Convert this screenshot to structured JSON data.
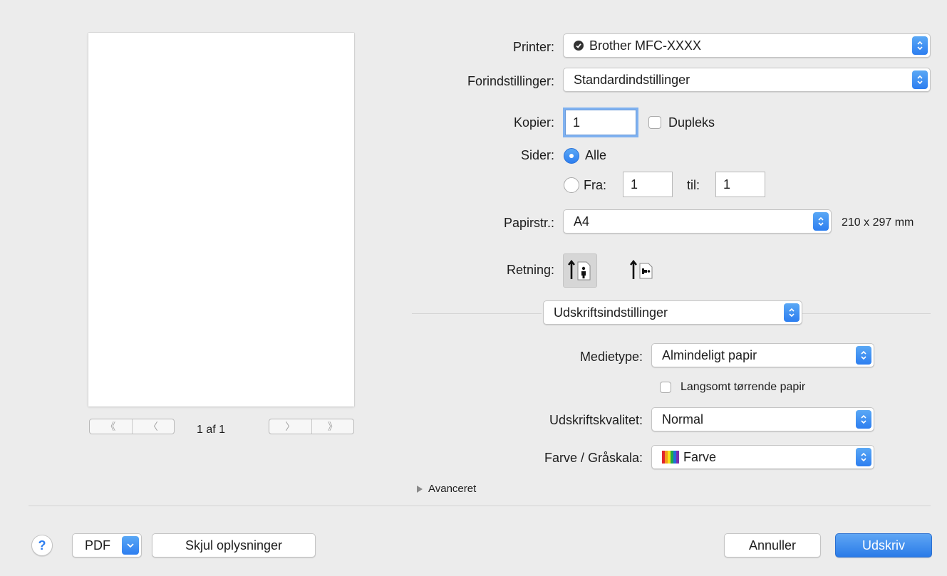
{
  "preview": {
    "page_counter": "1 af 1",
    "nav_first": "《",
    "nav_prev": "〈",
    "nav_next": "〉",
    "nav_last": "》"
  },
  "printer": {
    "label": "Printer:",
    "value": "Brother MFC-XXXX"
  },
  "presets": {
    "label": "Forindstillinger:",
    "value": "Standardindstillinger"
  },
  "copies": {
    "label": "Kopier:",
    "value": "1",
    "duplex_label": "Dupleks",
    "duplex_checked": false
  },
  "pages": {
    "label": "Sider:",
    "all_label": "Alle",
    "from_label": "Fra:",
    "from_value": "1",
    "to_label": "til:",
    "to_value": "1",
    "selected": "Alle"
  },
  "paper_size": {
    "label": "Papirstr.:",
    "value": "A4",
    "dimensions": "210 x 297 mm"
  },
  "orientation": {
    "label": "Retning:",
    "selected": "portrait"
  },
  "section": {
    "value": "Udskriftsindstillinger"
  },
  "media_type": {
    "label": "Medietype:",
    "value": "Almindeligt papir"
  },
  "slow_drying": {
    "label": "Langsomt tørrende papir",
    "checked": false
  },
  "quality": {
    "label": "Udskriftskvalitet:",
    "value": "Normal"
  },
  "color": {
    "label": "Farve / Gråskala:",
    "value": "Farve"
  },
  "advanced": {
    "label": "Avanceret"
  },
  "footer": {
    "help": "?",
    "pdf": "PDF",
    "hide_details": "Skjul oplysninger",
    "cancel": "Annuller",
    "print": "Udskriv"
  },
  "colors": {
    "accent": "#2d7ef0",
    "background": "#ececec"
  }
}
